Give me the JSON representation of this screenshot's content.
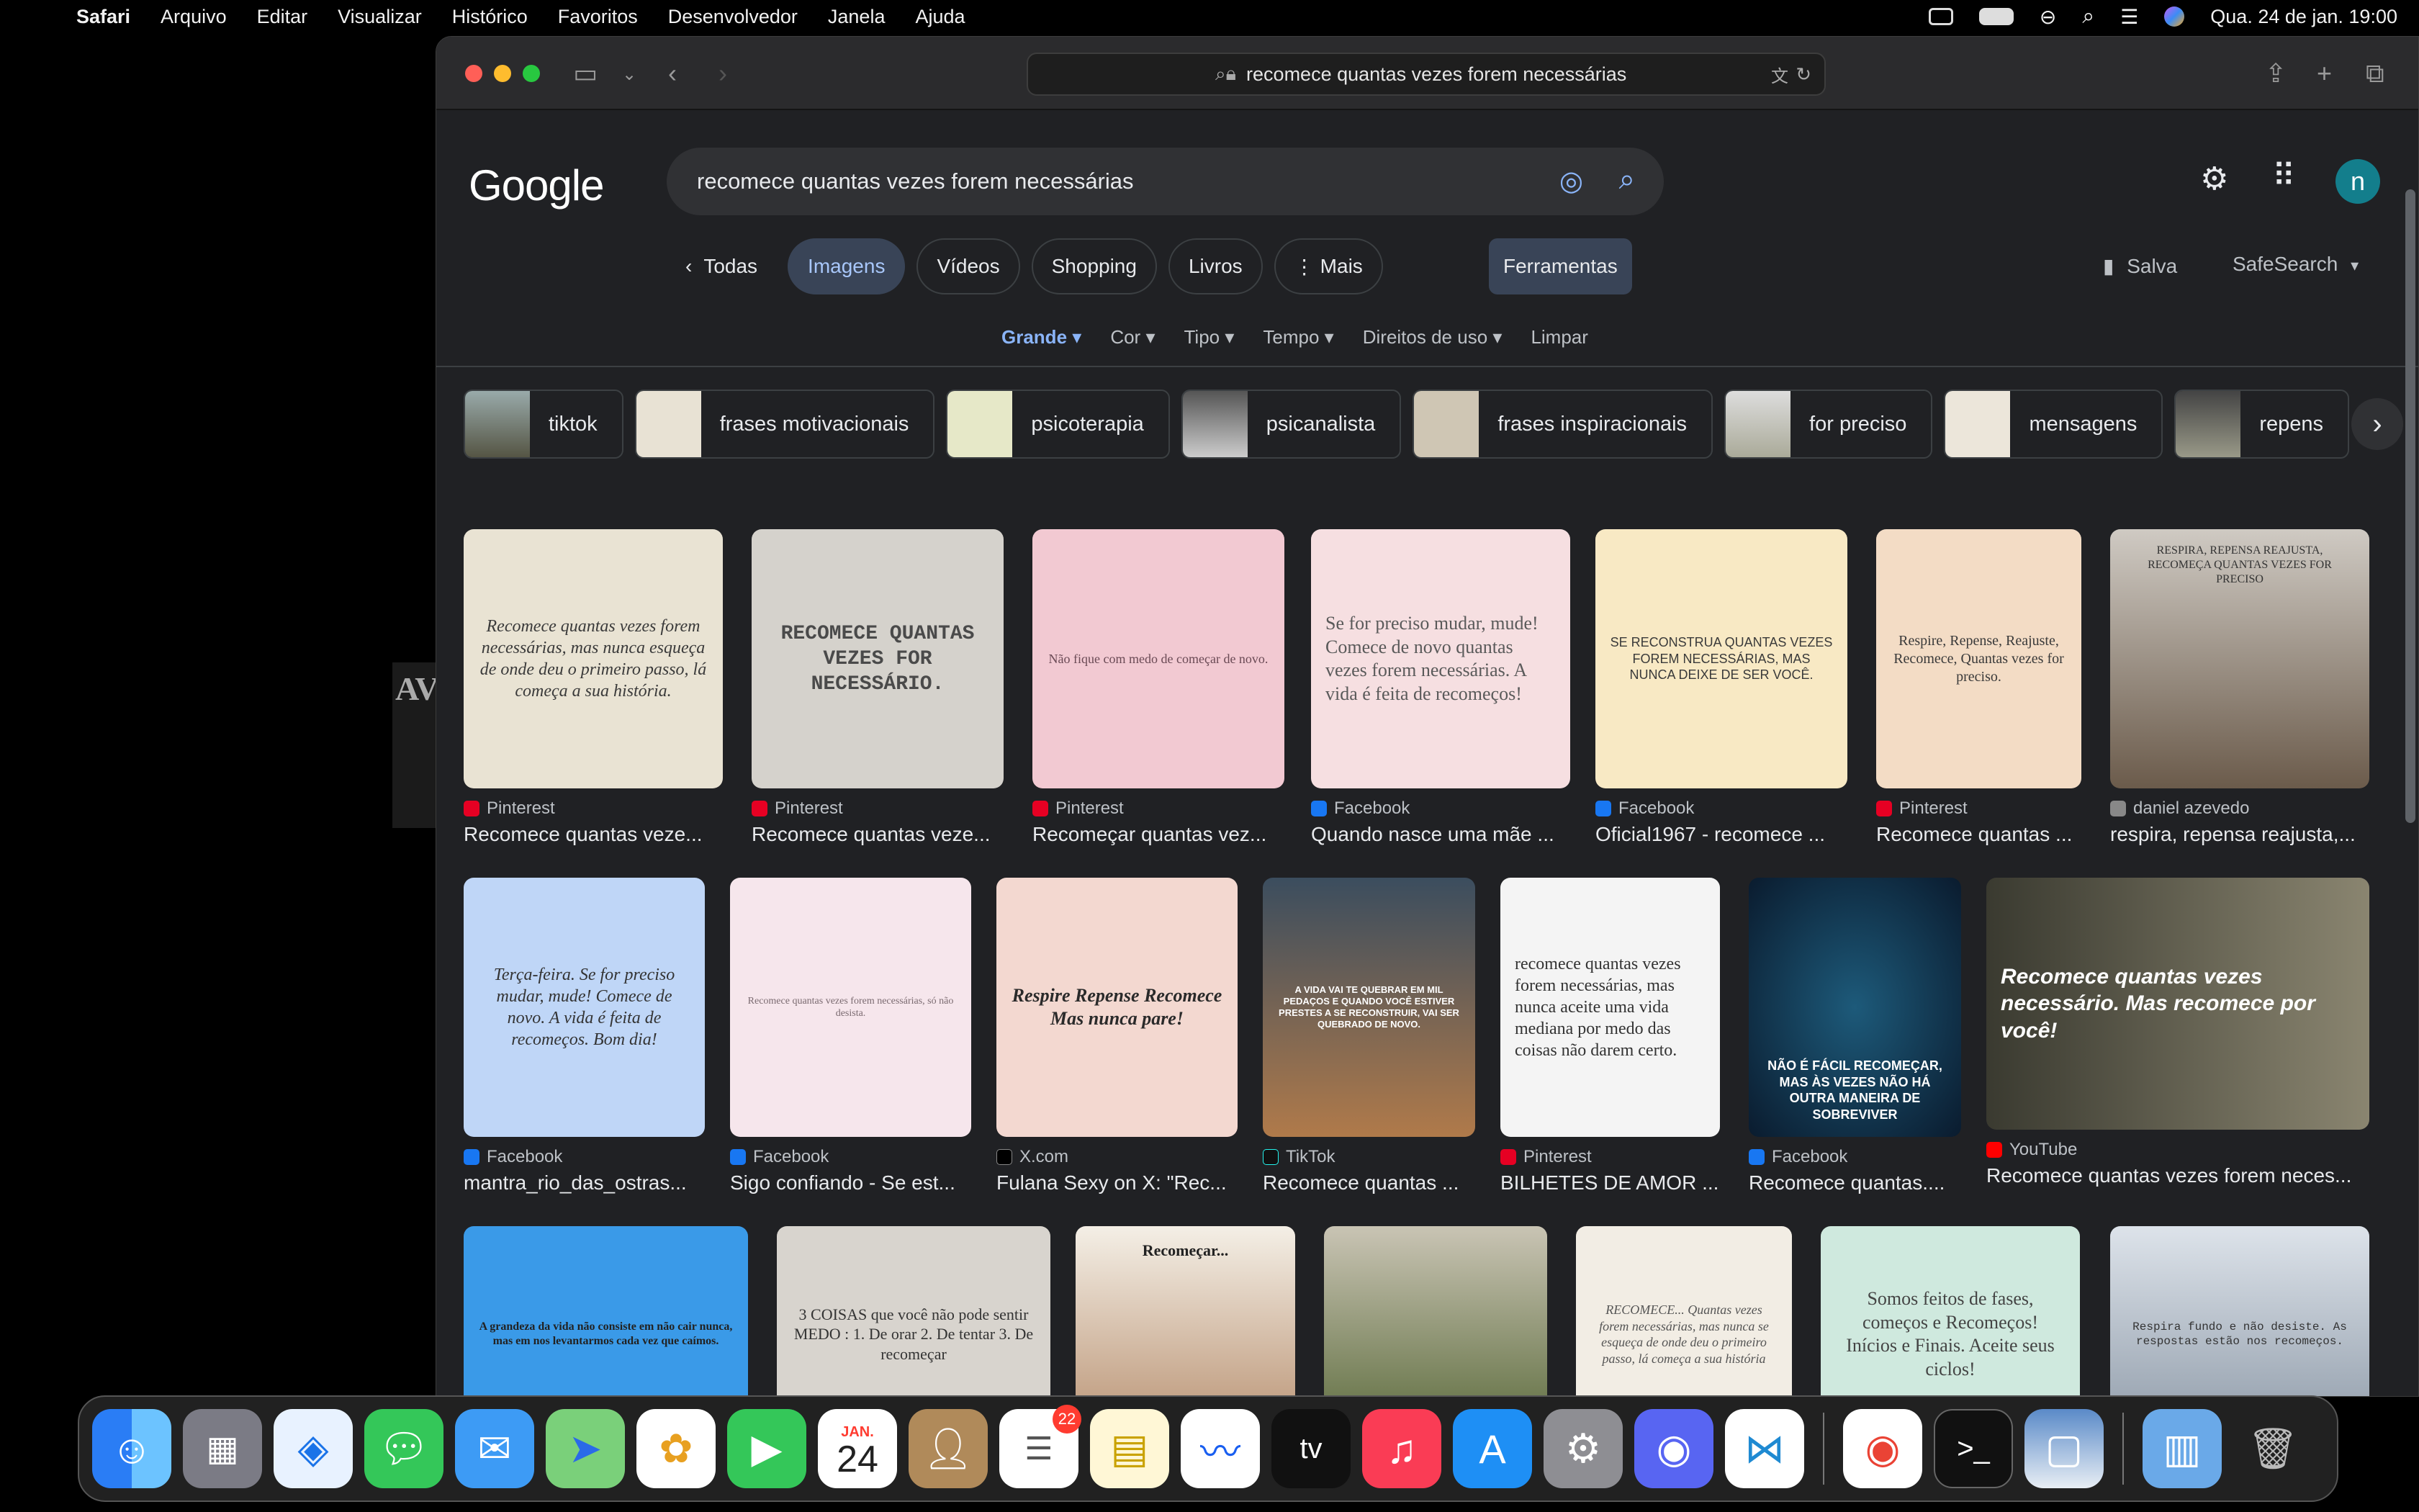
{
  "menubar": {
    "app": "Safari",
    "items": [
      "Arquivo",
      "Editar",
      "Visualizar",
      "Histórico",
      "Favoritos",
      "Desenvolvedor",
      "Janela",
      "Ajuda"
    ],
    "clock": "Qua. 24 de jan.  19:00"
  },
  "browser": {
    "url": "recomece quantas vezes forem necessárias"
  },
  "google": {
    "logo": "Google",
    "query": "recomece quantas vezes forem necessárias",
    "avatar_letter": "n",
    "tabs": [
      {
        "label": "Todas"
      },
      {
        "label": "Imagens"
      },
      {
        "label": "Vídeos"
      },
      {
        "label": "Shopping"
      },
      {
        "label": "Livros"
      },
      {
        "label": "Mais"
      }
    ],
    "tools": "Ferramentas",
    "salva": "Salva",
    "safesearch": "SafeSearch",
    "filters": [
      "Grande",
      "Cor",
      "Tipo",
      "Tempo",
      "Direitos de uso",
      "Limpar"
    ],
    "chips": [
      "tiktok",
      "frases motivacionais",
      "psicoterapia",
      "psicanalista",
      "frases inspiracionais",
      "for preciso",
      "mensagens",
      "repens"
    ]
  },
  "results_row1": [
    {
      "source": "Pinterest",
      "title": "Recomece quantas veze...",
      "img_text": "Recomece quantas vezes forem necessárias, mas nunca esqueça de onde deu o primeiro passo, lá começa a sua história."
    },
    {
      "source": "Pinterest",
      "title": "Recomece quantas veze...",
      "img_text": "RECOMECE QUANTAS VEZES FOR NECESSÁRIO."
    },
    {
      "source": "Pinterest",
      "title": "Recomeçar quantas vez...",
      "img_text": "Não fique com medo de começar de novo."
    },
    {
      "source": "Facebook",
      "title": "Quando nasce uma mãe ...",
      "img_text": "Se for preciso mudar, mude! Comece de novo quantas vezes forem necessárias. A vida é feita de recomeços!"
    },
    {
      "source": "Facebook",
      "title": "Oficial1967 - recomece ...",
      "img_text": "SE RECONSTRUA QUANTAS VEZES FOREM NECESSÁRIAS, MAS NUNCA DEIXE DE SER VOCÊ."
    },
    {
      "source": "Pinterest",
      "title": "Recomece quantas ...",
      "img_text": "Respire, Repense, Reajuste, Recomece, Quantas vezes for preciso."
    },
    {
      "source": "daniel azevedo",
      "title": "respira, repensa reajusta,...",
      "img_text": "RESPIRA, REPENSA REAJUSTA, RECOMEÇA QUANTAS VEZES FOR PRECISO"
    }
  ],
  "results_row2": [
    {
      "source": "Facebook",
      "title": "mantra_rio_das_ostras...",
      "img_text": "Terça-feira. Se for preciso mudar, mude! Comece de novo. A vida é feita de recomeços. Bom dia!"
    },
    {
      "source": "Facebook",
      "title": "Sigo confiando - Se est...",
      "img_text": "Recomece quantas vezes forem necessárias, só não desista."
    },
    {
      "source": "X.com",
      "title": "Fulana Sexy on X: \"Rec...",
      "img_text": "Respire Repense Recomece Mas nunca pare!"
    },
    {
      "source": "TikTok",
      "title": "Recomece quantas ...",
      "img_text": "A VIDA VAI TE QUEBRAR EM MIL PEDAÇOS E QUANDO VOCÊ ESTIVER PRESTES A SE RECONSTRUIR, VAI SER QUEBRADO DE NOVO."
    },
    {
      "source": "Pinterest",
      "title": "BILHETES DE AMOR ...",
      "img_text": "recomece quantas vezes forem necessárias, mas nunca aceite uma vida mediana por medo das coisas não darem certo."
    },
    {
      "source": "Facebook",
      "title": "Recomece quantas....",
      "img_text": "NÃO É FÁCIL RECOMEÇAR, MAS ÀS VEZES NÃO HÁ OUTRA MANEIRA DE SOBREVIVER"
    },
    {
      "source": "YouTube",
      "title": "Recomece quantas vezes forem neces...",
      "img_text": "Recomece quantas vezes necessário. Mas recomece por você!"
    }
  ],
  "results_row3": [
    {
      "img_text": "A grandeza da vida não consiste em não cair nunca, mas em nos levantarmos cada vez que caímos."
    },
    {
      "img_text": "3 COISAS que você não pode sentir MEDO : 1. De orar 2. De tentar 3. De recomeçar"
    },
    {
      "img_text": "Recomeçar..."
    },
    {
      "img_text": ""
    },
    {
      "img_text": "RECOMECE... Quantas vezes forem necessárias, mas nunca se esqueça de onde deu o primeiro passo, lá começa a sua história"
    },
    {
      "img_text": "Somos feitos de fases, começos e Recomeços! Inícios e Finais. Aceite seus ciclos!"
    },
    {
      "img_text": "Respira fundo e não desiste. As respostas estão nos recomeços."
    }
  ],
  "dock": {
    "calendar_month": "JAN.",
    "calendar_day": "24",
    "reminders_badge": "22"
  },
  "desk_strip_text": "AV"
}
